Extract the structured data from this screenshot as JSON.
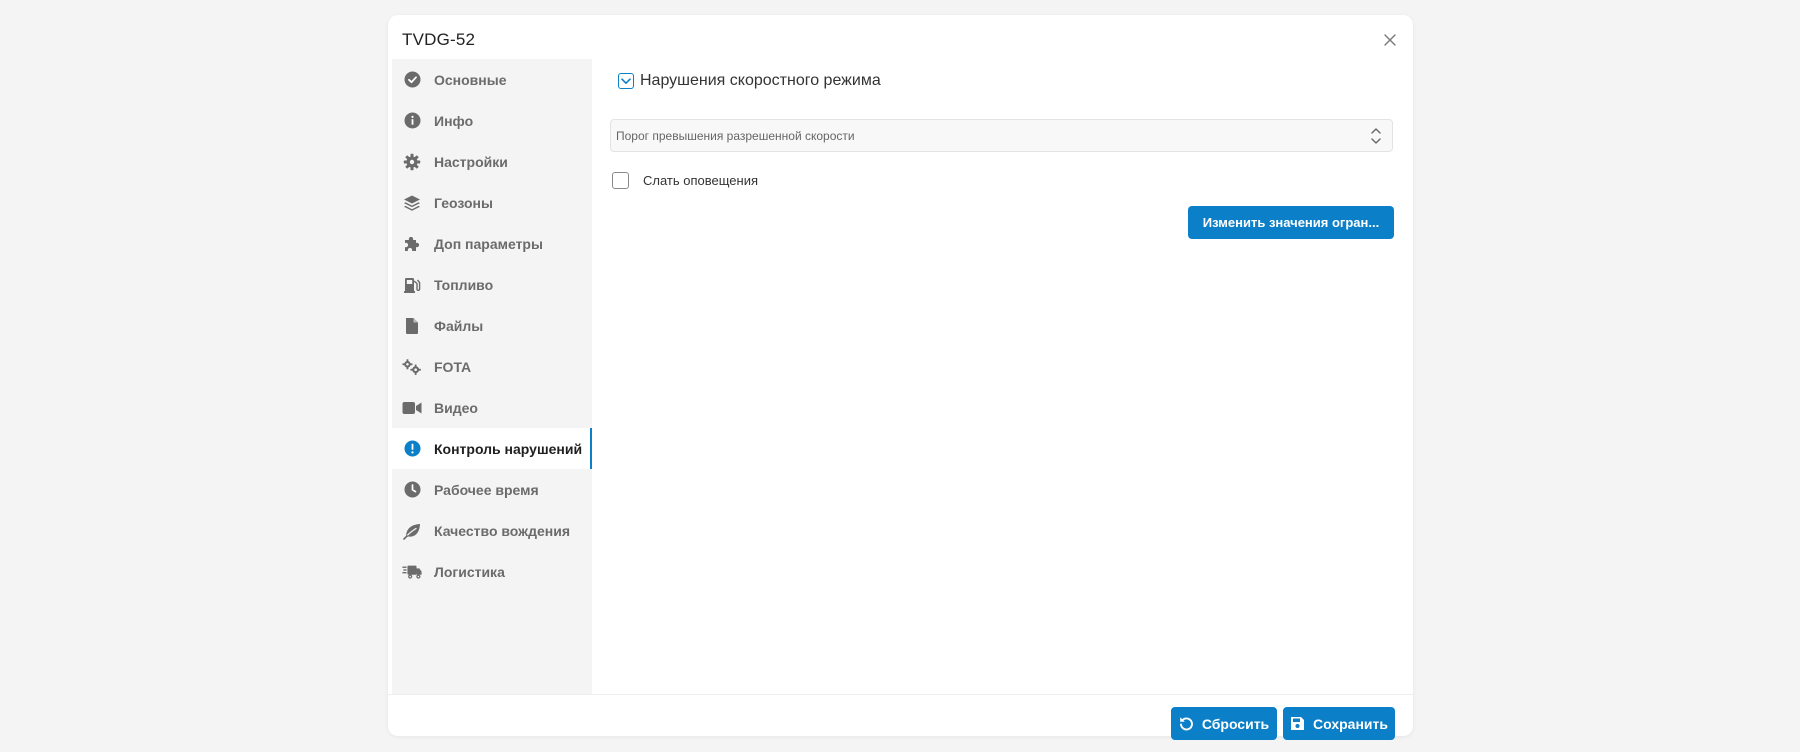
{
  "dialog": {
    "title": "TVDG-52"
  },
  "sidebar": {
    "items": [
      {
        "label": "Основные",
        "icon": "check-circle-icon"
      },
      {
        "label": "Инфо",
        "icon": "info-icon"
      },
      {
        "label": "Настройки",
        "icon": "gear-icon"
      },
      {
        "label": "Геозоны",
        "icon": "layers-icon"
      },
      {
        "label": "Доп параметры",
        "icon": "puzzle-icon"
      },
      {
        "label": "Топливо",
        "icon": "fuel-pump-icon"
      },
      {
        "label": "Файлы",
        "icon": "file-icon"
      },
      {
        "label": "FOTA",
        "icon": "gears-icon"
      },
      {
        "label": "Видео",
        "icon": "video-camera-icon"
      },
      {
        "label": "Контроль нарушений",
        "icon": "exclamation-circle-icon",
        "active": true
      },
      {
        "label": "Рабочее время",
        "icon": "clock-icon"
      },
      {
        "label": "Качество вождения",
        "icon": "leaf-icon"
      },
      {
        "label": "Логистика",
        "icon": "truck-icon"
      }
    ]
  },
  "content": {
    "section_title": "Нарушения скоростного режима",
    "threshold_placeholder": "Порог превышения разрешенной скорости",
    "notify_label": "Слать оповещения",
    "change_limits_label": "Изменить значения огран..."
  },
  "footer": {
    "reset_label": "Сбросить",
    "save_label": "Сохранить"
  },
  "colors": {
    "accent": "#0b7fc7",
    "sidebar_bg": "#f4f4f4",
    "icon_gray": "#6b6b6b"
  }
}
